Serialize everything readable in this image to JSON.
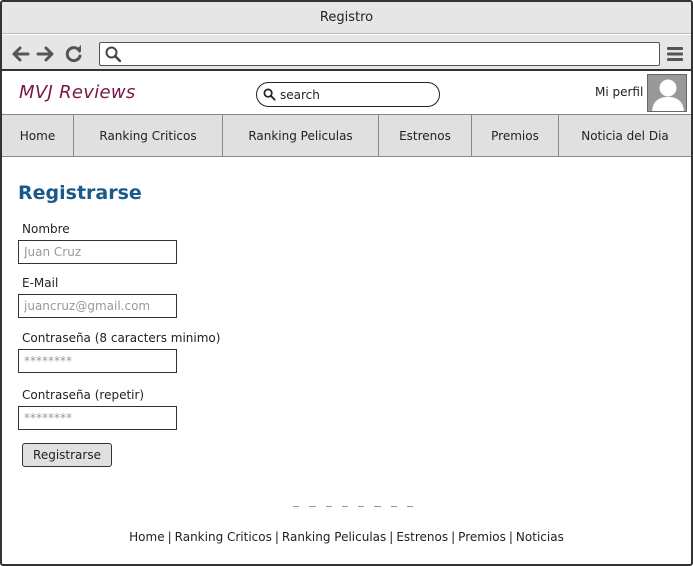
{
  "window": {
    "title": "Registro"
  },
  "browser": {
    "url": ""
  },
  "header": {
    "logo": "MVJ Reviews",
    "search_placeholder": "search",
    "profile_label": "Mi perfil"
  },
  "nav": {
    "items": [
      {
        "label": "Home"
      },
      {
        "label": "Ranking Criticos"
      },
      {
        "label": "Ranking Peliculas"
      },
      {
        "label": "Estrenos"
      },
      {
        "label": "Premios"
      },
      {
        "label": "Noticia del Dia"
      }
    ]
  },
  "form": {
    "title": "Registrarse",
    "name_label": "Nombre",
    "name_placeholder": "Juan Cruz",
    "email_label": "E-Mail",
    "email_placeholder": "juancruz@gmail.com",
    "password_label": "Contraseña (8 caracters minimo)",
    "password_placeholder": "********",
    "password_repeat_label": "Contraseña (repetir)",
    "password_repeat_placeholder": "********",
    "submit_label": "Registrarse"
  },
  "footer": {
    "links": [
      {
        "label": "Home"
      },
      {
        "label": "Ranking Criticos"
      },
      {
        "label": "Ranking Peliculas"
      },
      {
        "label": "Estrenos"
      },
      {
        "label": "Premios"
      },
      {
        "label": "Noticias"
      }
    ],
    "separator": "|"
  },
  "icons": {
    "back": "arrow-left-icon",
    "forward": "arrow-right-icon",
    "reload": "reload-icon",
    "url_search": "search-icon",
    "menu": "hamburger-menu-icon",
    "site_search": "search-icon",
    "avatar": "user-avatar-icon"
  },
  "colors": {
    "logo": "#7a1747",
    "form_title": "#1a5a8a",
    "chrome": "#e6e6e6",
    "nav_bg": "#e0e0e0"
  }
}
